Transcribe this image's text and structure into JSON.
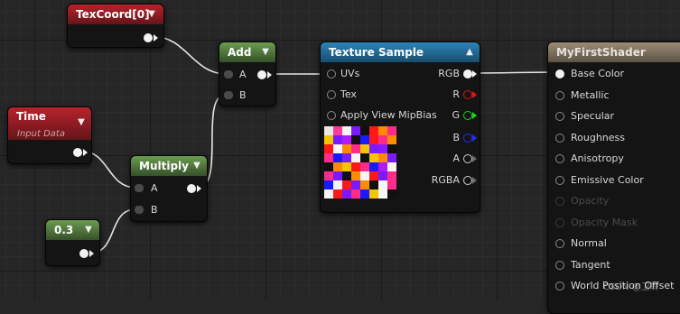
{
  "nodes": {
    "texcoord": {
      "title": "TexCoord[0]"
    },
    "time": {
      "title": "Time",
      "subtitle": "Input Data"
    },
    "constant": {
      "value": "0.3"
    },
    "multiply": {
      "title": "Multiply",
      "input_a": "A",
      "input_b": "B"
    },
    "add": {
      "title": "Add",
      "input_a": "A",
      "input_b": "B"
    },
    "texture_sample": {
      "title": "Texture Sample",
      "inputs": [
        "UVs",
        "Tex",
        "Apply View MipBias"
      ],
      "outputs": [
        "RGB",
        "R",
        "G",
        "B",
        "A",
        "RGBA"
      ],
      "preview_colors": [
        [
          "#e8e8e8",
          "#ff3a9a",
          "#f5f5f5",
          "#7a1aff",
          "#101010",
          "#ff1818",
          "#ff8c00",
          "#ff2a8a"
        ],
        [
          "#f5c400",
          "#7a1aff",
          "#b01aff",
          "#101010",
          "#1a1aff",
          "#ff1818",
          "#ff2a8a",
          "#ff8c00"
        ],
        [
          "#ff1818",
          "#f5f5f5",
          "#ff8c00",
          "#ff2a8a",
          "#f5c400",
          "#7a1aff",
          "#8c1aff",
          "#101010"
        ],
        [
          "#ff2a8a",
          "#1a1aff",
          "#7a1aff",
          "#f5f5f5",
          "#101010",
          "#f5c400",
          "#ff8c00",
          "#7a1aff"
        ],
        [
          "#101010",
          "#ff8c00",
          "#f5c400",
          "#ff1818",
          "#ff2a8a",
          "#1a1aff",
          "#b01aff",
          "#f5f5f5"
        ],
        [
          "#ff2a8a",
          "#7a1aff",
          "#101010",
          "#ff8c00",
          "#f5f5f5",
          "#ff1818",
          "#7a1aff",
          "#ff2a8a"
        ],
        [
          "#1a1aff",
          "#f5f5f5",
          "#ff1818",
          "#7a1aff",
          "#ff8c00",
          "#101010",
          "#f5f5f5",
          "#ff2a8a"
        ],
        [
          "#f5f5f5",
          "#ff1818",
          "#7a1aff",
          "#ff2a8a",
          "#1a1aff",
          "#f5c400",
          "#f5f5f5",
          "#101010"
        ]
      ]
    },
    "material": {
      "title": "MyFirstShader",
      "pins": [
        {
          "label": "Base Color",
          "connected": true,
          "enabled": true
        },
        {
          "label": "Metallic",
          "connected": false,
          "enabled": true
        },
        {
          "label": "Specular",
          "connected": false,
          "enabled": true
        },
        {
          "label": "Roughness",
          "connected": false,
          "enabled": true
        },
        {
          "label": "Anisotropy",
          "connected": false,
          "enabled": true
        },
        {
          "label": "Emissive Color",
          "connected": false,
          "enabled": true
        },
        {
          "label": "Opacity",
          "connected": false,
          "enabled": false
        },
        {
          "label": "Opacity Mask",
          "connected": false,
          "enabled": false
        },
        {
          "label": "Normal",
          "connected": false,
          "enabled": true
        },
        {
          "label": "Tangent",
          "connected": false,
          "enabled": true
        },
        {
          "label": "World Position Offset",
          "connected": false,
          "enabled": true
        }
      ]
    }
  },
  "watermark": "CSDN @卫聆",
  "colors": {
    "header_red": "#a51e26",
    "header_green": "#5e8c45",
    "header_blue": "#2778a8",
    "header_tan": "#8a7a66",
    "wire": "#e6e6e6",
    "pin_r": "#e0141e",
    "pin_g": "#18d818",
    "pin_b": "#2030f0"
  }
}
